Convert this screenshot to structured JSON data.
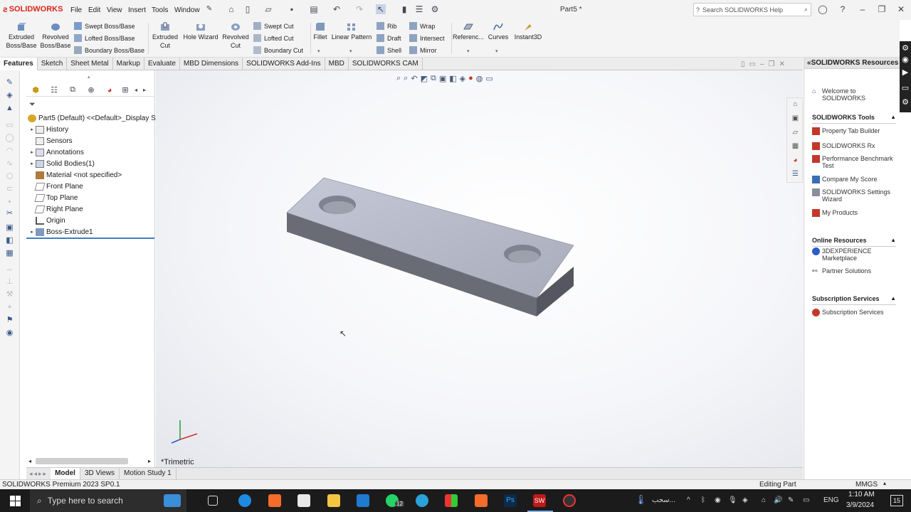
{
  "app": {
    "brand": "SOLIDWORKS",
    "doc_title": "Part5 *",
    "help_placeholder": "Search SOLIDWORKS Help"
  },
  "menu": [
    "File",
    "Edit",
    "View",
    "Insert",
    "Tools",
    "Window"
  ],
  "commands": {
    "extruded_boss": "Extruded Boss/Base",
    "revolved_boss": "Revolved Boss/Base",
    "swept_boss": "Swept Boss/Base",
    "lofted_boss": "Lofted Boss/Base",
    "boundary_boss": "Boundary Boss/Base",
    "extruded_cut": "Extruded Cut",
    "hole_wizard": "Hole Wizard",
    "revolved_cut": "Revolved Cut",
    "swept_cut": "Swept Cut",
    "lofted_cut": "Lofted Cut",
    "boundary_cut": "Boundary Cut",
    "fillet": "Fillet",
    "linear_pattern": "Linear Pattern",
    "rib": "Rib",
    "draft": "Draft",
    "shell": "Shell",
    "wrap": "Wrap",
    "intersect": "Intersect",
    "mirror": "Mirror",
    "reference": "Referenc...",
    "curves": "Curves",
    "instant3d": "Instant3D"
  },
  "tabs": [
    "Features",
    "Sketch",
    "Sheet Metal",
    "Markup",
    "Evaluate",
    "MBD Dimensions",
    "SOLIDWORKS Add-Ins",
    "MBD",
    "SOLIDWORKS CAM"
  ],
  "tree": {
    "root": "Part5 (Default) <<Default>_Display S",
    "items": [
      "History",
      "Sensors",
      "Annotations",
      "Solid Bodies(1)",
      "Material <not specified>",
      "Front Plane",
      "Top Plane",
      "Right Plane",
      "Origin",
      "Boss-Extrude1"
    ]
  },
  "viewport": {
    "view_label": "*Trimetric"
  },
  "bottom_tabs": [
    "Model",
    "3D Views",
    "Motion Study 1"
  ],
  "taskpane": {
    "title": "SOLIDWORKS Resources",
    "welcome": "Welcome to SOLIDWORKS",
    "tools_header": "SOLIDWORKS Tools",
    "tools": [
      "Property Tab Builder",
      "SOLIDWORKS Rx",
      "Performance Benchmark Test",
      "Compare My Score",
      "SOLIDWORKS Settings Wizard",
      "My Products"
    ],
    "online_header": "Online Resources",
    "online": [
      "3DEXPERIENCE Marketplace",
      "Partner Solutions"
    ],
    "sub_header": "Subscription Services",
    "sub": [
      "Subscription Services"
    ]
  },
  "status": {
    "version": "SOLIDWORKS Premium 2023 SP0.1",
    "mode": "Editing Part",
    "units": "MMGS"
  },
  "taskbar": {
    "search": "Type here to search",
    "weather": "سحب...",
    "lang": "ENG",
    "time": "1:10 AM",
    "date": "3/9/2024",
    "notif": "15",
    "whatsapp_badge": "12"
  },
  "colors": {
    "accent": "#d9261c",
    "taskbar": "#1b1b1b",
    "model_top": "#b9bccb",
    "model_side": "#6f727c"
  }
}
